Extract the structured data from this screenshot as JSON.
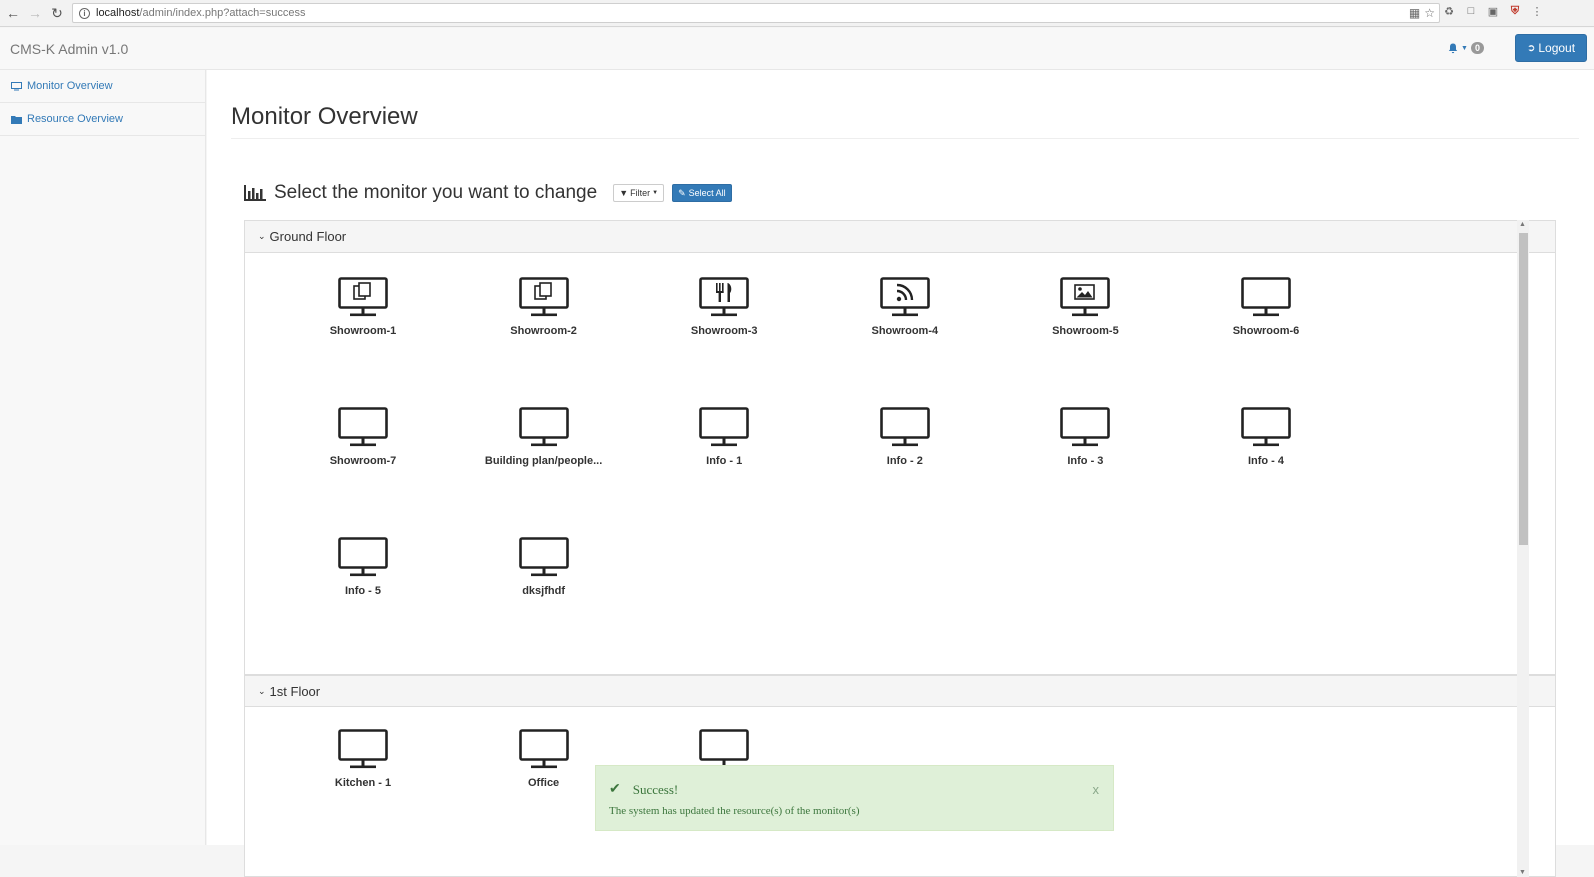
{
  "browser": {
    "url_host": "localhost",
    "url_path": "/admin/index.php?attach=success"
  },
  "navbar": {
    "brand": "CMS-K Admin v1.0",
    "notification_count": "0",
    "logout_label": "Logout"
  },
  "sidebar": {
    "items": [
      {
        "label": "Monitor Overview",
        "icon": "monitor-icon"
      },
      {
        "label": "Resource Overview",
        "icon": "folder-icon"
      }
    ]
  },
  "main": {
    "page_title": "Monitor Overview",
    "section_title": "Select the monitor you want to change",
    "filter_label": "Filter",
    "select_all_label": "Select All",
    "groups": [
      {
        "name": "Ground Floor",
        "monitors": [
          {
            "label": "Showroom-1",
            "icon": "copy"
          },
          {
            "label": "Showroom-2",
            "icon": "copy"
          },
          {
            "label": "Showroom-3",
            "icon": "cutlery"
          },
          {
            "label": "Showroom-4",
            "icon": "rss"
          },
          {
            "label": "Showroom-5",
            "icon": "image"
          },
          {
            "label": "Showroom-6",
            "icon": "none"
          },
          {
            "label": "Showroom-7",
            "icon": "none"
          },
          {
            "label": "Building plan/people...",
            "icon": "none"
          },
          {
            "label": "Info - 1",
            "icon": "none"
          },
          {
            "label": "Info - 2",
            "icon": "none"
          },
          {
            "label": "Info - 3",
            "icon": "none"
          },
          {
            "label": "Info - 4",
            "icon": "none"
          },
          {
            "label": "Info - 5",
            "icon": "none"
          },
          {
            "label": "dksjfhdf",
            "icon": "none"
          }
        ]
      },
      {
        "name": "1st Floor",
        "monitors": [
          {
            "label": "Kitchen - 1",
            "icon": "none"
          },
          {
            "label": "Office",
            "icon": "none"
          },
          {
            "label": "",
            "icon": "none"
          }
        ]
      }
    ]
  },
  "alert": {
    "title": "Success!",
    "message": "The system has updated the resource(s) of the monitor(s)",
    "close": "x"
  },
  "colors": {
    "primary": "#337ab7",
    "success_bg": "#dff0d8",
    "success_text": "#3c763d"
  }
}
